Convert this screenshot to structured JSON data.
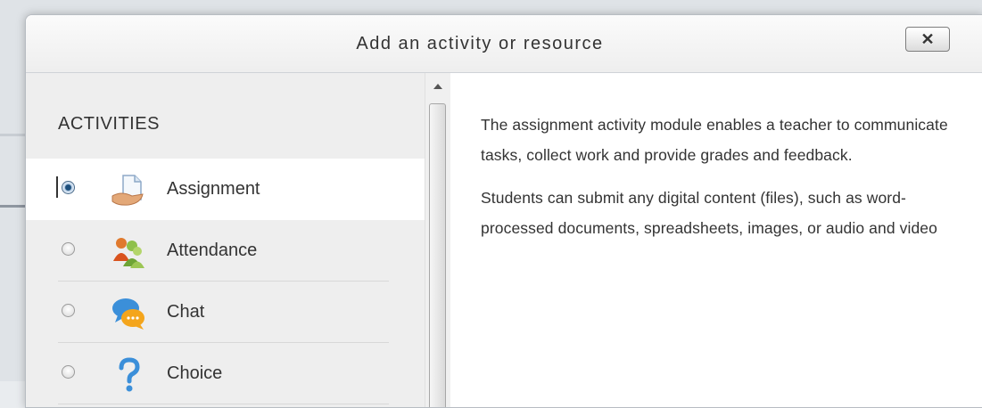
{
  "modal": {
    "title": "Add an activity or resource",
    "close_label": "✕"
  },
  "activities": {
    "heading": "ACTIVITIES",
    "items": [
      {
        "label": "Assignment",
        "icon": "assignment-icon",
        "selected": true
      },
      {
        "label": "Attendance",
        "icon": "attendance-icon",
        "selected": false
      },
      {
        "label": "Chat",
        "icon": "chat-icon",
        "selected": false
      },
      {
        "label": "Choice",
        "icon": "choice-icon",
        "selected": false
      }
    ]
  },
  "description": {
    "paragraphs": [
      "The assignment activity module enables a teacher to communicate tasks, collect work and provide grades and feedback.",
      "Students can submit any digital content (files), such as word-processed documents, spreadsheets, images, or audio and video"
    ]
  },
  "colors": {
    "header_bg": "#f2f2f2",
    "left_pane_bg": "#eeeeee",
    "selected_bg": "#ffffff",
    "text": "#333333",
    "radio_checked": "#1d4f7c"
  }
}
